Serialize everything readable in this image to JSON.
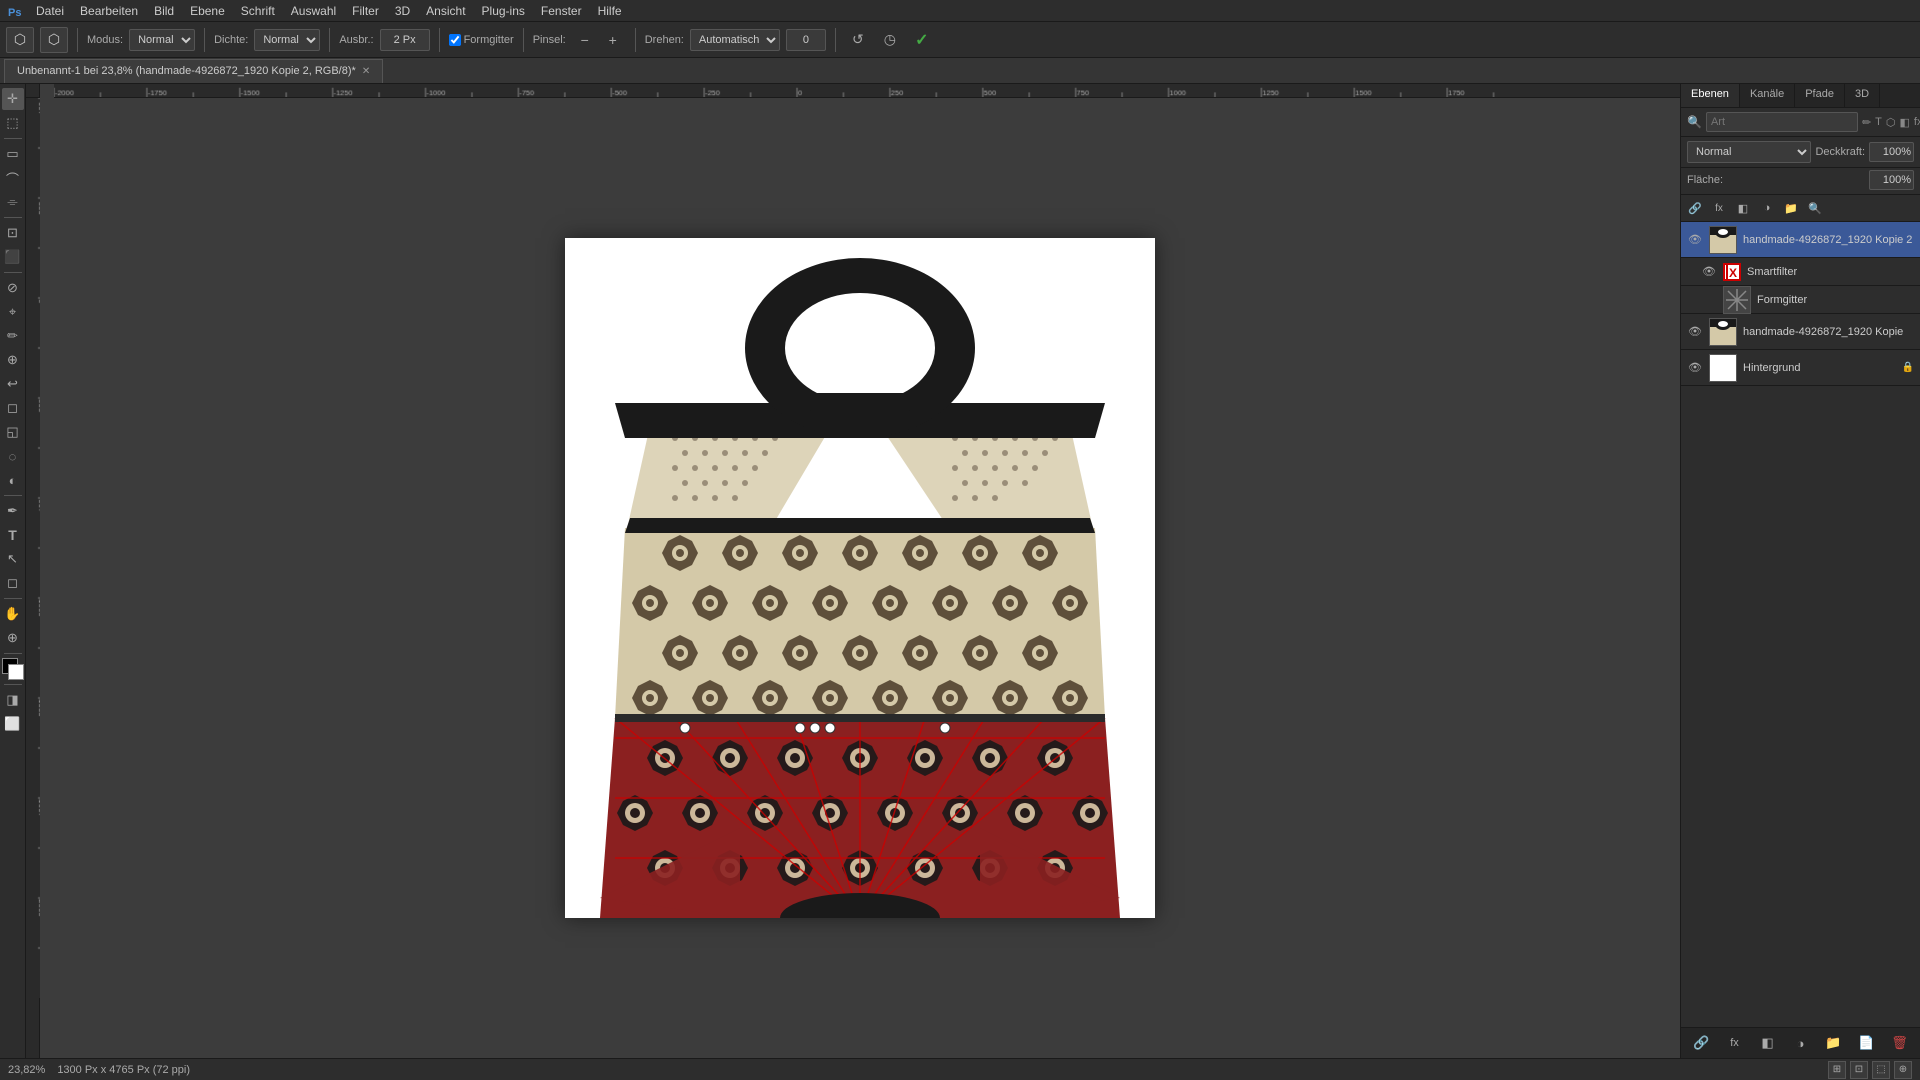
{
  "app": {
    "title": "Adobe Photoshop"
  },
  "menu": {
    "items": [
      "Datei",
      "Bearbeiten",
      "Bild",
      "Ebene",
      "Schrift",
      "Auswahl",
      "Filter",
      "3D",
      "Ansicht",
      "Plug-ins",
      "Fenster",
      "Hilfe"
    ]
  },
  "options_bar": {
    "modus_label": "Modus:",
    "modus_value": "Normal",
    "dichte_label": "Dichte:",
    "dichte_value": "Normal",
    "ausbr_label": "Ausbr.:",
    "ausbr_value": "2 Px",
    "formgitter_label": "Formgitter",
    "pinsel_label": "Pinsel:",
    "drehen_label": "Drehen:",
    "drehen_value": "Automatisch",
    "drehen_num": "0",
    "confirm_label": "✓"
  },
  "tab": {
    "title": "Unbenannt-1 bei 23,8% (handmade-4926872_1920 Kopie 2, RGB/8)*"
  },
  "canvas": {
    "zoom": "23,82%",
    "doc_size": "1300 Px x 4765 Px (72 ppi)"
  },
  "layers_panel": {
    "tabs": [
      "Ebenen",
      "Kanäle",
      "Pfade",
      "3D"
    ],
    "blend_mode": "Normal",
    "opacity_label": "Deckkraft:",
    "opacity_value": "100%",
    "fill_label": "Fläche:",
    "fill_value": "100%",
    "search_placeholder": "Art",
    "layers": [
      {
        "id": "layer1",
        "name": "handmade-4926872_1920 Kopie 2",
        "visible": true,
        "selected": true,
        "has_children": true,
        "locked": false,
        "thumb_color": "#8b7355"
      },
      {
        "id": "layer1a",
        "name": "Smartfilter",
        "visible": true,
        "selected": false,
        "is_sub": true,
        "type": "smartfilter",
        "thumb_color": "#c00"
      },
      {
        "id": "layer1b",
        "name": "Formgitter",
        "visible": true,
        "selected": false,
        "is_sub": true,
        "type": "formgitter",
        "thumb_color": "#888"
      },
      {
        "id": "layer2",
        "name": "handmade-4926872_1920 Kopie",
        "visible": true,
        "selected": false,
        "locked": false,
        "thumb_color": "#8b7355"
      },
      {
        "id": "layer3",
        "name": "Hintergrund",
        "visible": true,
        "selected": false,
        "locked": true,
        "thumb_color": "#ffffff"
      }
    ]
  },
  "status_bar": {
    "zoom": "23,82%",
    "doc_info": "1300 Px x 4765 Px (72 ppi)"
  }
}
